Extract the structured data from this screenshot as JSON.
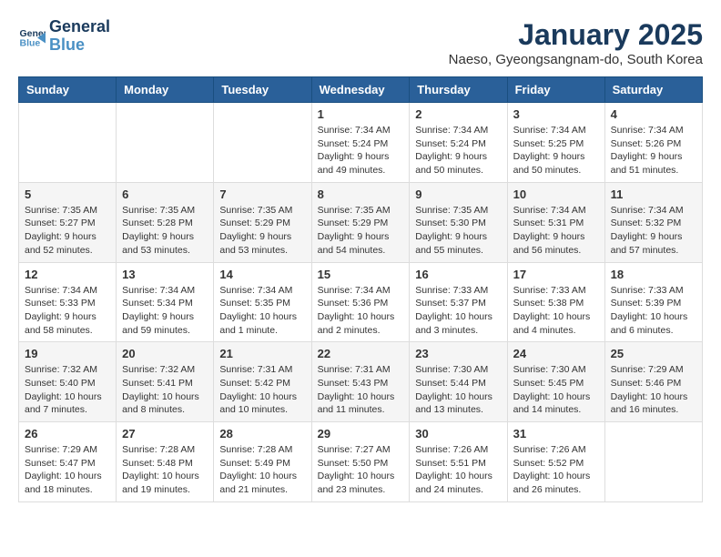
{
  "logo": {
    "line1": "General",
    "line2": "Blue"
  },
  "title": "January 2025",
  "subtitle": "Naeso, Gyeongsangnam-do, South Korea",
  "days_of_week": [
    "Sunday",
    "Monday",
    "Tuesday",
    "Wednesday",
    "Thursday",
    "Friday",
    "Saturday"
  ],
  "weeks": [
    [
      {
        "day": "",
        "content": ""
      },
      {
        "day": "",
        "content": ""
      },
      {
        "day": "",
        "content": ""
      },
      {
        "day": "1",
        "content": "Sunrise: 7:34 AM\nSunset: 5:24 PM\nDaylight: 9 hours\nand 49 minutes."
      },
      {
        "day": "2",
        "content": "Sunrise: 7:34 AM\nSunset: 5:24 PM\nDaylight: 9 hours\nand 50 minutes."
      },
      {
        "day": "3",
        "content": "Sunrise: 7:34 AM\nSunset: 5:25 PM\nDaylight: 9 hours\nand 50 minutes."
      },
      {
        "day": "4",
        "content": "Sunrise: 7:34 AM\nSunset: 5:26 PM\nDaylight: 9 hours\nand 51 minutes."
      }
    ],
    [
      {
        "day": "5",
        "content": "Sunrise: 7:35 AM\nSunset: 5:27 PM\nDaylight: 9 hours\nand 52 minutes."
      },
      {
        "day": "6",
        "content": "Sunrise: 7:35 AM\nSunset: 5:28 PM\nDaylight: 9 hours\nand 53 minutes."
      },
      {
        "day": "7",
        "content": "Sunrise: 7:35 AM\nSunset: 5:29 PM\nDaylight: 9 hours\nand 53 minutes."
      },
      {
        "day": "8",
        "content": "Sunrise: 7:35 AM\nSunset: 5:29 PM\nDaylight: 9 hours\nand 54 minutes."
      },
      {
        "day": "9",
        "content": "Sunrise: 7:35 AM\nSunset: 5:30 PM\nDaylight: 9 hours\nand 55 minutes."
      },
      {
        "day": "10",
        "content": "Sunrise: 7:34 AM\nSunset: 5:31 PM\nDaylight: 9 hours\nand 56 minutes."
      },
      {
        "day": "11",
        "content": "Sunrise: 7:34 AM\nSunset: 5:32 PM\nDaylight: 9 hours\nand 57 minutes."
      }
    ],
    [
      {
        "day": "12",
        "content": "Sunrise: 7:34 AM\nSunset: 5:33 PM\nDaylight: 9 hours\nand 58 minutes."
      },
      {
        "day": "13",
        "content": "Sunrise: 7:34 AM\nSunset: 5:34 PM\nDaylight: 9 hours\nand 59 minutes."
      },
      {
        "day": "14",
        "content": "Sunrise: 7:34 AM\nSunset: 5:35 PM\nDaylight: 10 hours\nand 1 minute."
      },
      {
        "day": "15",
        "content": "Sunrise: 7:34 AM\nSunset: 5:36 PM\nDaylight: 10 hours\nand 2 minutes."
      },
      {
        "day": "16",
        "content": "Sunrise: 7:33 AM\nSunset: 5:37 PM\nDaylight: 10 hours\nand 3 minutes."
      },
      {
        "day": "17",
        "content": "Sunrise: 7:33 AM\nSunset: 5:38 PM\nDaylight: 10 hours\nand 4 minutes."
      },
      {
        "day": "18",
        "content": "Sunrise: 7:33 AM\nSunset: 5:39 PM\nDaylight: 10 hours\nand 6 minutes."
      }
    ],
    [
      {
        "day": "19",
        "content": "Sunrise: 7:32 AM\nSunset: 5:40 PM\nDaylight: 10 hours\nand 7 minutes."
      },
      {
        "day": "20",
        "content": "Sunrise: 7:32 AM\nSunset: 5:41 PM\nDaylight: 10 hours\nand 8 minutes."
      },
      {
        "day": "21",
        "content": "Sunrise: 7:31 AM\nSunset: 5:42 PM\nDaylight: 10 hours\nand 10 minutes."
      },
      {
        "day": "22",
        "content": "Sunrise: 7:31 AM\nSunset: 5:43 PM\nDaylight: 10 hours\nand 11 minutes."
      },
      {
        "day": "23",
        "content": "Sunrise: 7:30 AM\nSunset: 5:44 PM\nDaylight: 10 hours\nand 13 minutes."
      },
      {
        "day": "24",
        "content": "Sunrise: 7:30 AM\nSunset: 5:45 PM\nDaylight: 10 hours\nand 14 minutes."
      },
      {
        "day": "25",
        "content": "Sunrise: 7:29 AM\nSunset: 5:46 PM\nDaylight: 10 hours\nand 16 minutes."
      }
    ],
    [
      {
        "day": "26",
        "content": "Sunrise: 7:29 AM\nSunset: 5:47 PM\nDaylight: 10 hours\nand 18 minutes."
      },
      {
        "day": "27",
        "content": "Sunrise: 7:28 AM\nSunset: 5:48 PM\nDaylight: 10 hours\nand 19 minutes."
      },
      {
        "day": "28",
        "content": "Sunrise: 7:28 AM\nSunset: 5:49 PM\nDaylight: 10 hours\nand 21 minutes."
      },
      {
        "day": "29",
        "content": "Sunrise: 7:27 AM\nSunset: 5:50 PM\nDaylight: 10 hours\nand 23 minutes."
      },
      {
        "day": "30",
        "content": "Sunrise: 7:26 AM\nSunset: 5:51 PM\nDaylight: 10 hours\nand 24 minutes."
      },
      {
        "day": "31",
        "content": "Sunrise: 7:26 AM\nSunset: 5:52 PM\nDaylight: 10 hours\nand 26 minutes."
      },
      {
        "day": "",
        "content": ""
      }
    ]
  ]
}
